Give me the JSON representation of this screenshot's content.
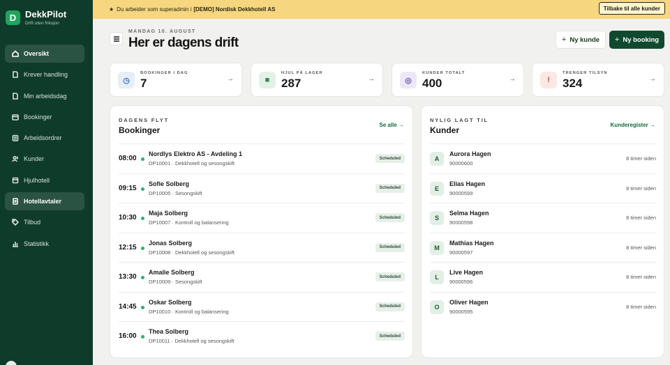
{
  "brand": {
    "logo_letter": "D",
    "name": "DekkPilot",
    "tagline": "Drift uten friksjon"
  },
  "sidebar": {
    "items": [
      {
        "label": "Oversikt",
        "icon": "home-icon",
        "active": true
      },
      {
        "label": "Krever handling",
        "icon": "file-icon",
        "active": false
      },
      {
        "label": "Min arbeidsdag",
        "icon": "file-icon",
        "active": false
      },
      {
        "label": "Bookinger",
        "icon": "calendar-icon",
        "active": false
      },
      {
        "label": "Arbeidsordrer",
        "icon": "clipboard-icon",
        "active": false
      },
      {
        "label": "Kunder",
        "icon": "users-icon",
        "active": false
      },
      {
        "label": "Hjulhotell",
        "icon": "box-icon",
        "active": false
      },
      {
        "label": "Hotellavtaler",
        "icon": "document-icon",
        "active": true
      },
      {
        "label": "Tilbud",
        "icon": "tag-icon",
        "active": false
      },
      {
        "label": "Statistikk",
        "icon": "chart-icon",
        "active": false
      }
    ]
  },
  "banner": {
    "star": "★",
    "prefix": "Du arbeider som superadmin i",
    "org": "[DEMO] Nordisk Dekkhotell AS",
    "back_label": "Tilbake til alle kunder"
  },
  "header": {
    "date": "MANDAG 10. AUGUST",
    "title": "Her er dagens drift",
    "new_customer": "Ny kunde",
    "new_booking": "Ny booking",
    "plus": "+"
  },
  "stats": [
    {
      "label": "BOOKINGER I DAG",
      "value": "7",
      "icon": "clock-icon",
      "glyph": "◷",
      "bg": "#e6eef8",
      "fg": "#3a6fb0"
    },
    {
      "label": "HJUL PÅ LAGER",
      "value": "287",
      "icon": "box-icon",
      "glyph": "■",
      "bg": "#e3f1e7",
      "fg": "#2f8a53"
    },
    {
      "label": "KUNDER TOTALT",
      "value": "400",
      "icon": "users-icon",
      "glyph": "◎",
      "bg": "#ece8f7",
      "fg": "#6a5aa8"
    },
    {
      "label": "TRENGER TILSYN",
      "value": "324",
      "icon": "alert-icon",
      "glyph": "!",
      "bg": "#fbe8e3",
      "fg": "#c0502c"
    }
  ],
  "stat_arrow": "→",
  "bookings": {
    "eyebrow": "DAGENS FLYT",
    "title": "Bookinger",
    "link": "Se alle →",
    "rows": [
      {
        "time": "08:00",
        "name": "Nordlys Elektro AS - Avdeling 1",
        "sub": "DP10001 · Dekkhotell og sesongskift",
        "status": "Scheduled"
      },
      {
        "time": "09:15",
        "name": "Sofie Solberg",
        "sub": "DP10005 · Sesongskift",
        "status": "Scheduled"
      },
      {
        "time": "10:30",
        "name": "Maja Solberg",
        "sub": "DP10007 · Kontroll og balansering",
        "status": "Scheduled"
      },
      {
        "time": "12:15",
        "name": "Jonas Solberg",
        "sub": "DP10008 · Dekkhotell og sesongskift",
        "status": "Scheduled"
      },
      {
        "time": "13:30",
        "name": "Amalie Solberg",
        "sub": "DP10009 · Sesongskift",
        "status": "Scheduled"
      },
      {
        "time": "14:45",
        "name": "Oskar Solberg",
        "sub": "DP10010 · Kontroll og balansering",
        "status": "Scheduled"
      },
      {
        "time": "16:00",
        "name": "Thea Solberg",
        "sub": "DP10011 · Dekkhotell og sesongskift",
        "status": "Scheduled"
      }
    ]
  },
  "customers": {
    "eyebrow": "NYLIG LAGT TIL",
    "title": "Kunder",
    "link": "Kunderegister →",
    "rows": [
      {
        "initial": "A",
        "name": "Aurora Hagen",
        "phone": "90000600",
        "ago": "8 timer siden"
      },
      {
        "initial": "E",
        "name": "Elias Hagen",
        "phone": "90000599",
        "ago": "8 timer siden"
      },
      {
        "initial": "S",
        "name": "Selma Hagen",
        "phone": "90000598",
        "ago": "8 timer siden"
      },
      {
        "initial": "M",
        "name": "Mathias Hagen",
        "phone": "90000597",
        "ago": "8 timer siden"
      },
      {
        "initial": "L",
        "name": "Live Hagen",
        "phone": "90000596",
        "ago": "8 timer siden"
      },
      {
        "initial": "O",
        "name": "Oliver Hagen",
        "phone": "90000595",
        "ago": "8 timer siden"
      }
    ]
  }
}
